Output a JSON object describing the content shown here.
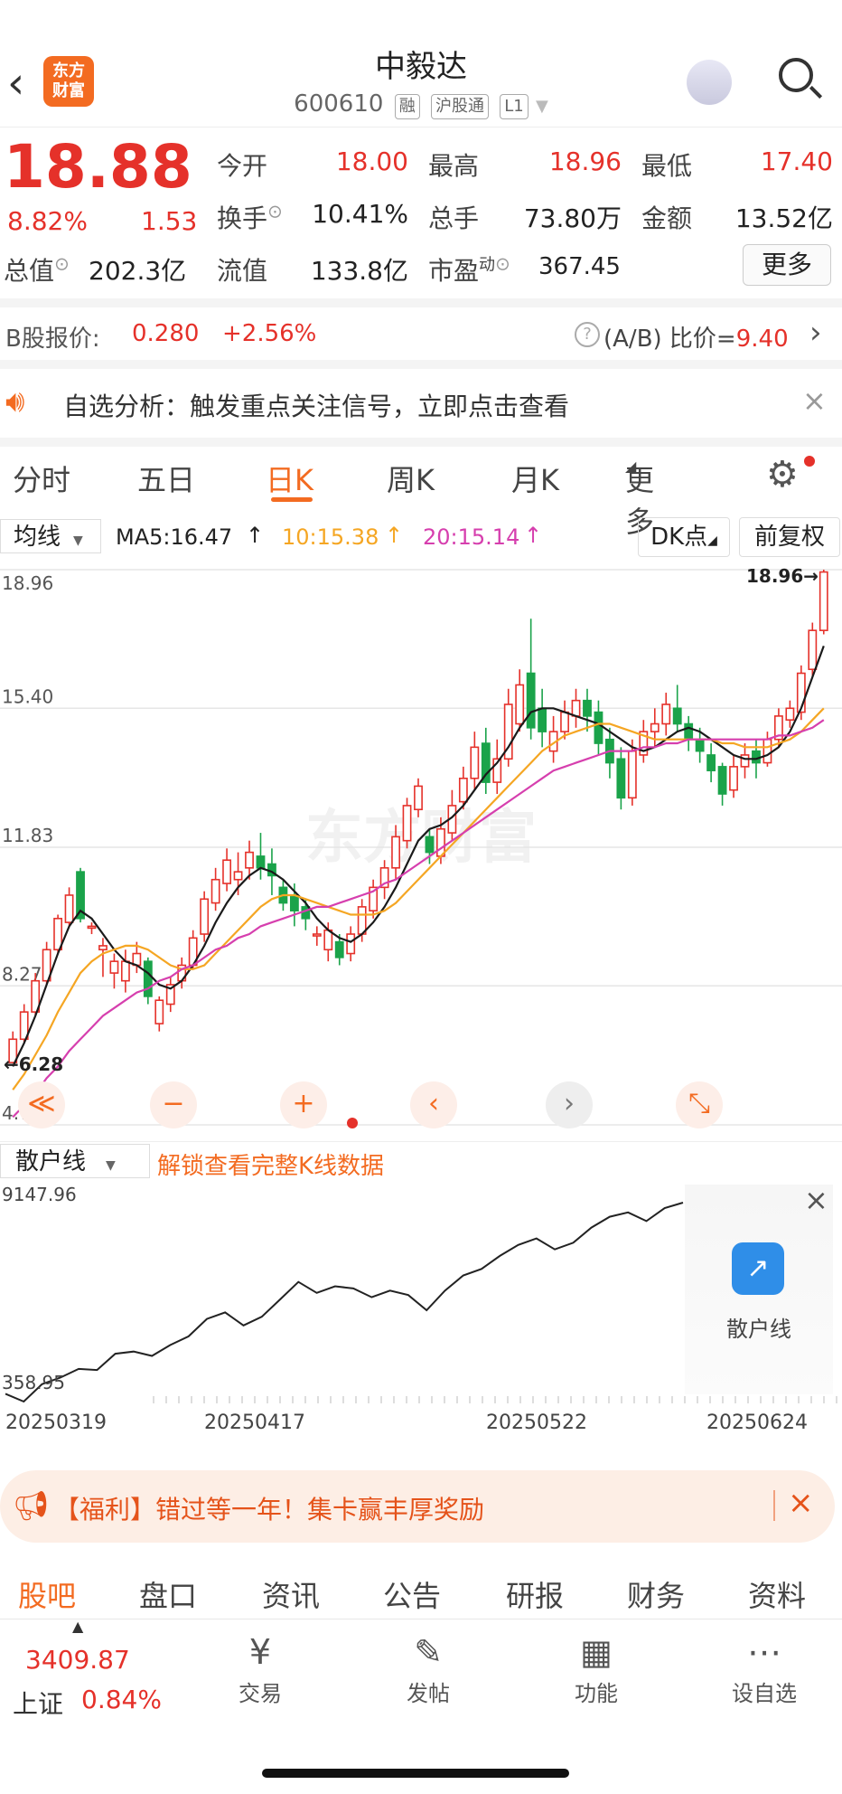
{
  "header": {
    "title": "中毅达",
    "code": "600610",
    "tags": [
      "融",
      "沪股通",
      "L1"
    ],
    "logo_lines": [
      "东方",
      "财富"
    ]
  },
  "quote": {
    "price": "18.88",
    "change_pct": "8.82%",
    "change": "1.53",
    "row1": [
      {
        "label": "今开",
        "value": "18.00"
      },
      {
        "label": "最高",
        "value": "18.96"
      },
      {
        "label": "最低",
        "value": "17.40"
      }
    ],
    "row2": [
      {
        "label": "换手",
        "value": "10.41%"
      },
      {
        "label": "总手",
        "value": "73.80万"
      },
      {
        "label": "金额",
        "value": "13.52亿"
      }
    ],
    "row3": [
      {
        "label": "总值",
        "value": "202.3亿"
      },
      {
        "label": "流值",
        "value": "133.8亿"
      },
      {
        "label": "市盈",
        "sup": "动",
        "value": "367.45"
      }
    ],
    "more_button": "更多"
  },
  "bshare": {
    "label": "B股报价:",
    "price": "0.280",
    "change": "+2.56%",
    "ratio_label": "(A/B) 比价=",
    "ratio_value": "9.40"
  },
  "notice": {
    "text": "自选分析：触发重点关注信号，立即点击查看"
  },
  "chart_tabs": {
    "items": [
      "分时",
      "五日",
      "日K",
      "周K",
      "月K",
      "更多"
    ],
    "active": "日K"
  },
  "indicator_bar": {
    "selector": "均线",
    "ma5": "MA5:16.47",
    "ma10": "10:15.38",
    "ma20": "20:15.14",
    "dk_button": "DK点",
    "adjust_button": "前复权"
  },
  "chart_data": {
    "type": "candlestick",
    "y_ticks": [
      "18.96",
      "15.40",
      "11.83",
      "8.27",
      "4.70"
    ],
    "ylim": [
      4.7,
      18.96
    ],
    "annotations": {
      "high": "18.96",
      "low": "6.28"
    },
    "candles_ohlc": [
      [
        6.3,
        6.9,
        6.28,
        7.1
      ],
      [
        6.9,
        7.6,
        6.8,
        7.8
      ],
      [
        7.6,
        8.4,
        7.5,
        8.6
      ],
      [
        8.4,
        9.2,
        8.3,
        9.4
      ],
      [
        9.2,
        10.0,
        9.1,
        10.1
      ],
      [
        9.9,
        10.6,
        9.8,
        10.8
      ],
      [
        11.2,
        10.0,
        9.9,
        11.3
      ],
      [
        9.8,
        9.8,
        9.6,
        9.9
      ],
      [
        9.2,
        9.3,
        8.5,
        9.5
      ],
      [
        8.6,
        8.9,
        8.2,
        9.1
      ],
      [
        8.4,
        8.9,
        8.1,
        9.2
      ],
      [
        8.8,
        9.1,
        8.6,
        9.4
      ],
      [
        8.9,
        8.0,
        7.8,
        9.0
      ],
      [
        7.3,
        7.9,
        7.1,
        8.0
      ],
      [
        7.8,
        8.3,
        7.6,
        8.5
      ],
      [
        8.4,
        8.8,
        8.2,
        9.0
      ],
      [
        8.8,
        9.5,
        8.7,
        9.7
      ],
      [
        9.6,
        10.5,
        9.4,
        10.7
      ],
      [
        10.4,
        11.0,
        10.2,
        11.3
      ],
      [
        10.9,
        11.5,
        10.7,
        11.8
      ],
      [
        11.0,
        11.2,
        10.6,
        11.7
      ],
      [
        11.3,
        11.7,
        11.0,
        12.0
      ],
      [
        11.6,
        11.3,
        11.0,
        12.2
      ],
      [
        11.4,
        11.1,
        10.6,
        11.8
      ],
      [
        10.8,
        10.4,
        10.2,
        11.0
      ],
      [
        10.6,
        10.2,
        9.8,
        10.9
      ],
      [
        10.3,
        10.0,
        9.7,
        10.5
      ],
      [
        9.6,
        9.6,
        9.3,
        9.8
      ],
      [
        9.2,
        9.7,
        8.9,
        9.9
      ],
      [
        9.4,
        9.0,
        8.8,
        9.6
      ],
      [
        9.1,
        9.6,
        8.9,
        9.8
      ],
      [
        9.6,
        10.3,
        9.4,
        10.5
      ],
      [
        10.2,
        10.8,
        10.0,
        11.0
      ],
      [
        10.8,
        11.3,
        10.5,
        11.5
      ],
      [
        11.3,
        12.1,
        11.0,
        12.4
      ],
      [
        12.0,
        12.9,
        11.8,
        13.1
      ],
      [
        12.8,
        13.4,
        12.6,
        13.6
      ],
      [
        12.1,
        11.7,
        11.4,
        12.3
      ],
      [
        11.6,
        12.3,
        11.4,
        12.6
      ],
      [
        12.2,
        12.9,
        12.0,
        13.3
      ],
      [
        13.0,
        13.6,
        12.8,
        13.9
      ],
      [
        13.6,
        14.4,
        13.3,
        14.8
      ],
      [
        14.5,
        13.5,
        13.2,
        14.9
      ],
      [
        13.5,
        14.1,
        13.2,
        14.6
      ],
      [
        14.1,
        15.5,
        13.9,
        15.9
      ],
      [
        15.0,
        16.0,
        14.8,
        16.4
      ],
      [
        16.3,
        14.9,
        14.6,
        17.7
      ],
      [
        15.4,
        14.8,
        14.4,
        15.9
      ],
      [
        14.3,
        14.8,
        14.0,
        15.2
      ],
      [
        14.8,
        15.3,
        14.6,
        15.6
      ],
      [
        15.2,
        15.6,
        14.9,
        15.9
      ],
      [
        15.6,
        15.2,
        14.8,
        15.9
      ],
      [
        15.3,
        14.5,
        14.2,
        15.6
      ],
      [
        14.6,
        14.0,
        13.6,
        14.9
      ],
      [
        14.1,
        13.1,
        12.8,
        14.4
      ],
      [
        13.1,
        14.3,
        12.9,
        14.6
      ],
      [
        14.2,
        14.8,
        14.0,
        15.1
      ],
      [
        14.8,
        15.0,
        14.4,
        15.4
      ],
      [
        15.0,
        15.5,
        14.7,
        15.8
      ],
      [
        15.4,
        15.0,
        14.8,
        16.0
      ],
      [
        15.0,
        14.6,
        14.3,
        15.2
      ],
      [
        14.6,
        14.3,
        14.0,
        14.9
      ],
      [
        14.2,
        13.8,
        13.5,
        14.5
      ],
      [
        13.9,
        13.2,
        12.9,
        14.0
      ],
      [
        13.3,
        13.9,
        13.1,
        14.2
      ],
      [
        13.9,
        14.2,
        13.6,
        14.5
      ],
      [
        14.3,
        14.0,
        13.6,
        14.6
      ],
      [
        14.0,
        14.6,
        13.9,
        14.8
      ],
      [
        14.6,
        15.2,
        14.4,
        15.4
      ],
      [
        15.1,
        15.4,
        14.9,
        15.6
      ],
      [
        15.3,
        16.3,
        15.1,
        16.5
      ],
      [
        16.4,
        17.4,
        16.2,
        17.6
      ],
      [
        17.4,
        18.9,
        17.3,
        18.96
      ]
    ],
    "ma_lines": [
      {
        "name": "MA5",
        "color": "#1a1a1a",
        "values": [
          6.2,
          6.8,
          7.5,
          8.3,
          9.1,
          9.8,
          10.2,
          10.0,
          9.6,
          9.2,
          8.9,
          8.8,
          8.6,
          8.3,
          8.2,
          8.4,
          8.8,
          9.3,
          9.9,
          10.4,
          10.8,
          11.1,
          11.3,
          11.2,
          11.0,
          10.7,
          10.4,
          10.0,
          9.7,
          9.5,
          9.4,
          9.6,
          9.9,
          10.3,
          10.8,
          11.4,
          12.0,
          12.3,
          12.4,
          12.6,
          12.9,
          13.3,
          13.7,
          14.0,
          14.4,
          14.9,
          15.3,
          15.4,
          15.4,
          15.3,
          15.2,
          15.1,
          15.0,
          14.8,
          14.6,
          14.4,
          14.3,
          14.4,
          14.6,
          14.8,
          14.9,
          14.8,
          14.6,
          14.4,
          14.2,
          14.1,
          14.1,
          14.2,
          14.4,
          14.8,
          15.4,
          16.2,
          17.0
        ]
      },
      {
        "name": "MA10",
        "color": "#f5a623",
        "values": [
          5.6,
          6.0,
          6.5,
          7.0,
          7.6,
          8.1,
          8.6,
          8.9,
          9.1,
          9.2,
          9.3,
          9.3,
          9.2,
          9.0,
          8.8,
          8.7,
          8.7,
          8.8,
          9.1,
          9.4,
          9.7,
          10.0,
          10.3,
          10.5,
          10.6,
          10.6,
          10.5,
          10.4,
          10.3,
          10.2,
          10.1,
          10.1,
          10.1,
          10.2,
          10.4,
          10.7,
          11.0,
          11.3,
          11.6,
          11.9,
          12.2,
          12.5,
          12.8,
          13.1,
          13.4,
          13.7,
          14.0,
          14.3,
          14.5,
          14.7,
          14.8,
          14.9,
          15.0,
          15.0,
          14.9,
          14.8,
          14.7,
          14.6,
          14.6,
          14.6,
          14.6,
          14.6,
          14.6,
          14.5,
          14.5,
          14.4,
          14.4,
          14.4,
          14.5,
          14.6,
          14.8,
          15.1,
          15.4
        ]
      },
      {
        "name": "MA20",
        "color": "#d63fae",
        "values": [
          4.9,
          5.2,
          5.5,
          5.9,
          6.2,
          6.6,
          6.9,
          7.2,
          7.5,
          7.7,
          7.9,
          8.1,
          8.2,
          8.4,
          8.5,
          8.7,
          8.8,
          9.0,
          9.2,
          9.3,
          9.5,
          9.6,
          9.8,
          9.9,
          10.0,
          10.1,
          10.2,
          10.3,
          10.3,
          10.4,
          10.5,
          10.6,
          10.7,
          10.9,
          11.0,
          11.2,
          11.4,
          11.6,
          11.8,
          12.0,
          12.2,
          12.4,
          12.6,
          12.8,
          13.0,
          13.2,
          13.4,
          13.6,
          13.8,
          13.9,
          14.0,
          14.1,
          14.2,
          14.3,
          14.3,
          14.3,
          14.4,
          14.4,
          14.5,
          14.5,
          14.6,
          14.6,
          14.6,
          14.6,
          14.6,
          14.6,
          14.6,
          14.6,
          14.7,
          14.7,
          14.8,
          14.9,
          15.1
        ]
      }
    ],
    "watermark": "东方财富"
  },
  "chart_controls": [
    "≪",
    "−",
    "+",
    "‹",
    "›",
    "⤡"
  ],
  "sub_chart": {
    "selector": "散户线",
    "unlock_text": "解锁查看完整K线数据",
    "y_max": "9147.96",
    "y_min": "358.95",
    "dates": [
      "20250319",
      "20250417",
      "20250522",
      "20250624"
    ],
    "line_values": [
      358.95,
      0,
      800,
      1100,
      1500,
      1450,
      2200,
      2300,
      2100,
      2600,
      3000,
      3800,
      4100,
      3500,
      3900,
      4700,
      5500,
      5000,
      5300,
      5200,
      4800,
      5100,
      4900,
      4200,
      5100,
      5800,
      6100,
      6700,
      7200,
      7500,
      7000,
      7300,
      8000,
      8500,
      8700,
      8300,
      8900,
      9147.96
    ],
    "promo_label": "散户线"
  },
  "banner": {
    "text": "【福利】错过等一年！集卡赢丰厚奖励"
  },
  "bottom_tabs": {
    "items": [
      "股吧",
      "盘口",
      "资讯",
      "公告",
      "研报",
      "财务",
      "资料"
    ],
    "active": "股吧"
  },
  "nav": {
    "index_value": "3409.87",
    "index_name": "上证",
    "index_change": "0.84%",
    "items": [
      {
        "label": "交易",
        "icon": "¥"
      },
      {
        "label": "发帖",
        "icon": "✎"
      },
      {
        "label": "功能",
        "icon": "▦"
      },
      {
        "label": "设自选",
        "icon": "⋯"
      }
    ]
  },
  "colors": {
    "up": "#e5312a",
    "down": "#1aa34a",
    "accent": "#f36b21"
  }
}
